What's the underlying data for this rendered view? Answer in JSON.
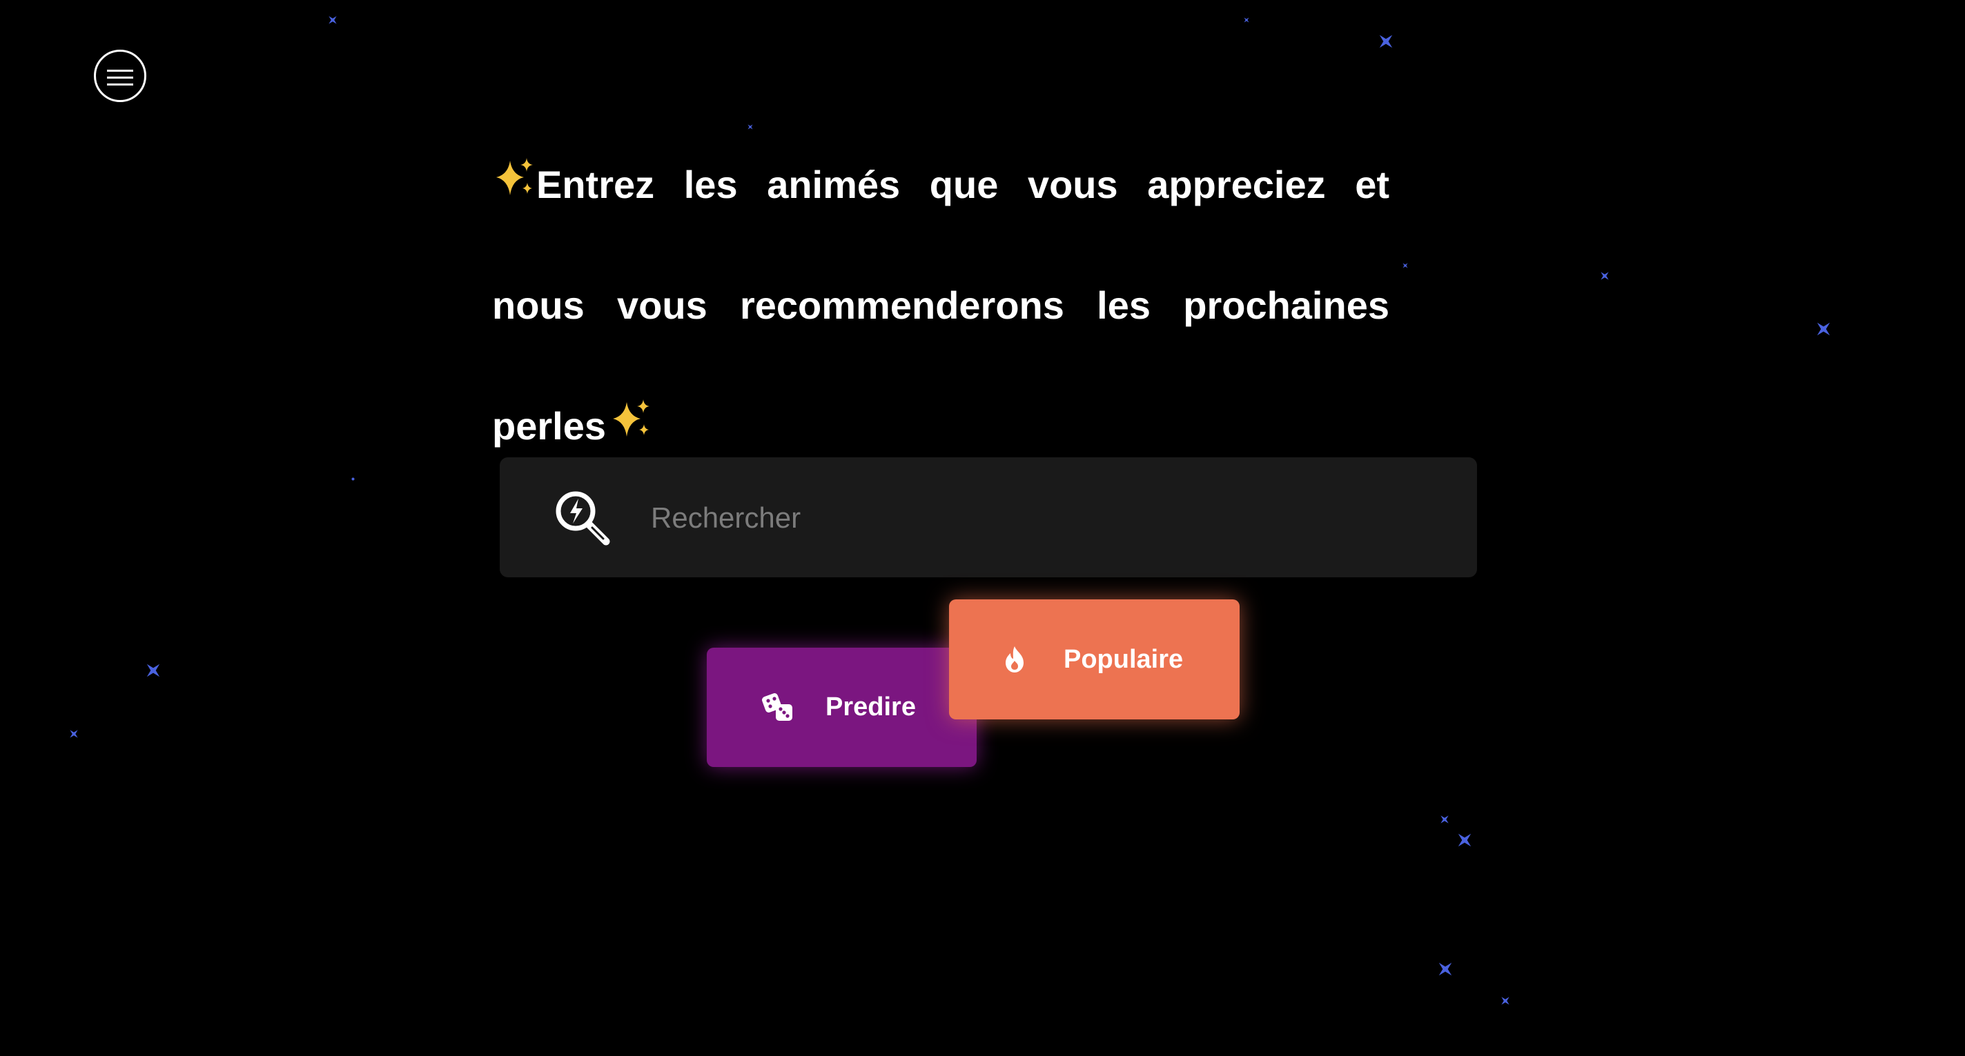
{
  "menu": {
    "icon": "hamburger-menu-icon"
  },
  "heading": {
    "line1": "Entrez les animés que vous appreciez et",
    "line2": "nous vous recommenderons les prochaines",
    "line3": "perles",
    "sparkle_icon": "sparkles-icon"
  },
  "search": {
    "icon": "search-icon",
    "placeholder": "Rechercher",
    "value": ""
  },
  "buttons": {
    "predict": {
      "label": "Predire",
      "icon": "dice-icon",
      "color": "#7b1680"
    },
    "popular": {
      "label": "Populaire",
      "icon": "fire-icon",
      "color": "#ed7351"
    }
  },
  "colors": {
    "background": "#000000",
    "star": "#4a62e0",
    "search_background": "#1a1a1a"
  }
}
